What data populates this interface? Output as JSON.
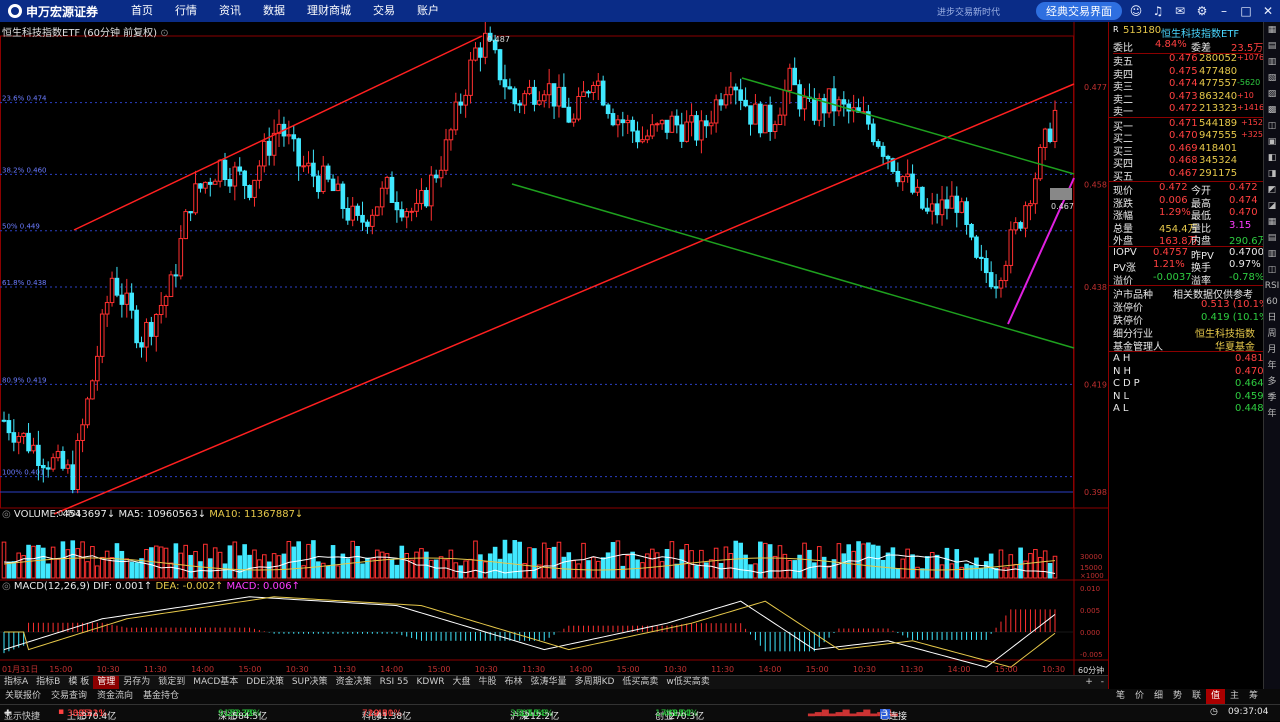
{
  "app": {
    "brand": "申万宏源证券",
    "brand_en": "SHENWAN HONGYUAN SECURITIES"
  },
  "nav": [
    "首页",
    "行情",
    "资讯",
    "数据",
    "理财商城",
    "交易",
    "账户"
  ],
  "top_right": {
    "ad_text": "进步交易新时代",
    "classic_button": "经典交易界面"
  },
  "chart": {
    "title": "恒生科技指数ETF (60分钟 前复权)",
    "high_label": "0.487",
    "low_label": "0.401",
    "last_label": "0.467",
    "price_axis": [
      "0.477",
      "0.458",
      "0.438",
      "0.419",
      "0.398"
    ],
    "fib_labels": [
      "23.6% 0.474",
      "38.2% 0.460",
      "50% 0.449",
      "61.8% 0.438",
      "80.9% 0.419",
      "100% 0.401"
    ],
    "vol_legend": {
      "vol": "VOLUME: 4543697↓",
      "ma5": "MA5: 10960563↓",
      "ma10": "MA10: 11367887↓"
    },
    "vol_axis": [
      "30000",
      "15000",
      "×1000"
    ],
    "macd_legend": {
      "name": "MACD(12,26,9)",
      "dif": "DIF: 0.001↑",
      "dea": "DEA: -0.002↑",
      "macd": "MACD: 0.006↑"
    },
    "macd_axis": [
      "0.010",
      "0.005",
      "0.000",
      "-0.005"
    ],
    "time_axis": [
      "01月31日",
      "15:00",
      "10:30",
      "11:30",
      "14:00",
      "15:00",
      "10:30",
      "11:30",
      "14:00",
      "15:00",
      "10:30",
      "11:30",
      "14:00",
      "15:00",
      "10:30",
      "11:30",
      "14:00",
      "15:00",
      "10:30",
      "11:30",
      "14:00",
      "15:00",
      "10:30"
    ],
    "period": "60分钟"
  },
  "bottom_tabs": [
    "指标A",
    "指标B",
    "模 板",
    "管理",
    "另存为",
    "锁定到",
    "MACD基本",
    "DDE决策",
    "SUP决策",
    "资金决策",
    "RSI 55",
    "KDWR",
    "大盘",
    "牛股",
    "布林",
    "弦涛华量",
    "多周期KD",
    "低买高卖",
    "w低买高卖"
  ],
  "bottom_tabs2": [
    "关联报价",
    "交易查询",
    "资金流向",
    "基金持仓"
  ],
  "side": {
    "code": "513180",
    "name": "恒生科技指数ETF",
    "webi": {
      "label": "委比",
      "value": "4.84%",
      "label2": "委差",
      "value2": "23.5万"
    },
    "asks": [
      {
        "label": "卖五",
        "price": "0.476",
        "vol": "280052",
        "chg": "+1076"
      },
      {
        "label": "卖四",
        "price": "0.475",
        "vol": "477480",
        "chg": ""
      },
      {
        "label": "卖三",
        "price": "0.474",
        "vol": "477557",
        "chg": "-5620"
      },
      {
        "label": "卖二",
        "price": "0.473",
        "vol": "863240",
        "chg": "+10"
      },
      {
        "label": "卖一",
        "price": "0.472",
        "vol": "213323",
        "chg": "+14163"
      }
    ],
    "bids": [
      {
        "label": "买一",
        "price": "0.471",
        "vol": "544189",
        "chg": "+15219"
      },
      {
        "label": "买二",
        "price": "0.470",
        "vol": "947555",
        "chg": "+325"
      },
      {
        "label": "买三",
        "price": "0.469",
        "vol": "418401",
        "chg": ""
      },
      {
        "label": "买四",
        "price": "0.468",
        "vol": "345324",
        "chg": ""
      },
      {
        "label": "买五",
        "price": "0.467",
        "vol": "291175",
        "chg": ""
      }
    ],
    "stats": [
      {
        "l1": "现价",
        "v1": "0.472",
        "c1": "red",
        "l2": "今开",
        "v2": "0.472",
        "c2": "red"
      },
      {
        "l1": "涨跌",
        "v1": "0.006",
        "c1": "red",
        "l2": "最高",
        "v2": "0.474",
        "c2": "red"
      },
      {
        "l1": "涨幅",
        "v1": "1.29%",
        "c1": "red",
        "l2": "最低",
        "v2": "0.470",
        "c2": "red"
      },
      {
        "l1": "总量",
        "v1": "454.4万",
        "c1": "yellow",
        "l2": "量比",
        "v2": "3.15",
        "c2": "magenta"
      },
      {
        "l1": "外盘",
        "v1": "163.8万",
        "c1": "red",
        "l2": "内盘",
        "v2": "290.6万",
        "c2": "green"
      }
    ],
    "iopv": [
      {
        "l1": "IOPV",
        "v1": "0.4757",
        "c1": "red",
        "l2": "昨PV",
        "v2": "0.4700",
        "c2": "white"
      },
      {
        "l1": "PV涨",
        "v1": "1.21%",
        "c1": "red",
        "l2": "换手",
        "v2": "0.97%",
        "c2": "white"
      },
      {
        "l1": "溢价",
        "v1": "-0.0037",
        "c1": "green",
        "l2": "溢率",
        "v2": "-0.78%",
        "c2": "green"
      }
    ],
    "market_label": "沪市品种",
    "market_note": "相关数据仅供参考",
    "limit_up": {
      "label": "涨停价",
      "value": "0.513 (10.1%)"
    },
    "limit_down": {
      "label": "跌停价",
      "value": "0.419 (10.1%)"
    },
    "industry": {
      "label": "细分行业",
      "value": "恒生科技指数"
    },
    "manager": {
      "label": "基金管理人",
      "value": "华夏基金"
    },
    "levels": [
      {
        "label": "AH",
        "value": "0.481",
        "c": "red"
      },
      {
        "label": "NH",
        "value": "0.470",
        "c": "red"
      },
      {
        "label": "CDP",
        "value": "0.464",
        "c": "green"
      },
      {
        "label": "NL",
        "value": "0.459",
        "c": "green"
      },
      {
        "label": "AL",
        "value": "0.448",
        "c": "green"
      }
    ]
  },
  "right_strip": [
    "RSI",
    "60",
    "日",
    "周",
    "月",
    "年",
    "多",
    "季",
    "年"
  ],
  "right_buttons": [
    "笔",
    "价",
    "细",
    "势",
    "联",
    "值",
    "主",
    "筹"
  ],
  "status": {
    "show_label": "显示快捷",
    "sh": {
      "name": "上证",
      "v": "3025.21",
      "c": "3.23",
      "p": "0.11%",
      "amt": "370.4亿"
    },
    "sz": {
      "name": "深证",
      "v": "9153.79",
      "c": "-29.35",
      "p": "-0.32%",
      "amt": "584.5亿"
    },
    "kc": {
      "name": "科创",
      "v": "729.31",
      "c": "1.46",
      "p": "0.20%",
      "amt": "41.38亿"
    },
    "hs": {
      "name": "沪深",
      "v": "3504.68",
      "c": "-1.55",
      "p": "-0.04%",
      "amt": "212.2亿"
    },
    "cy": {
      "name": "创业",
      "v": "1748.91",
      "c": "-4.25",
      "p": "-0.24%",
      "amt": "270.3亿"
    },
    "conn_count": "3",
    "conn": "已连接",
    "time": "09:37:04"
  }
}
